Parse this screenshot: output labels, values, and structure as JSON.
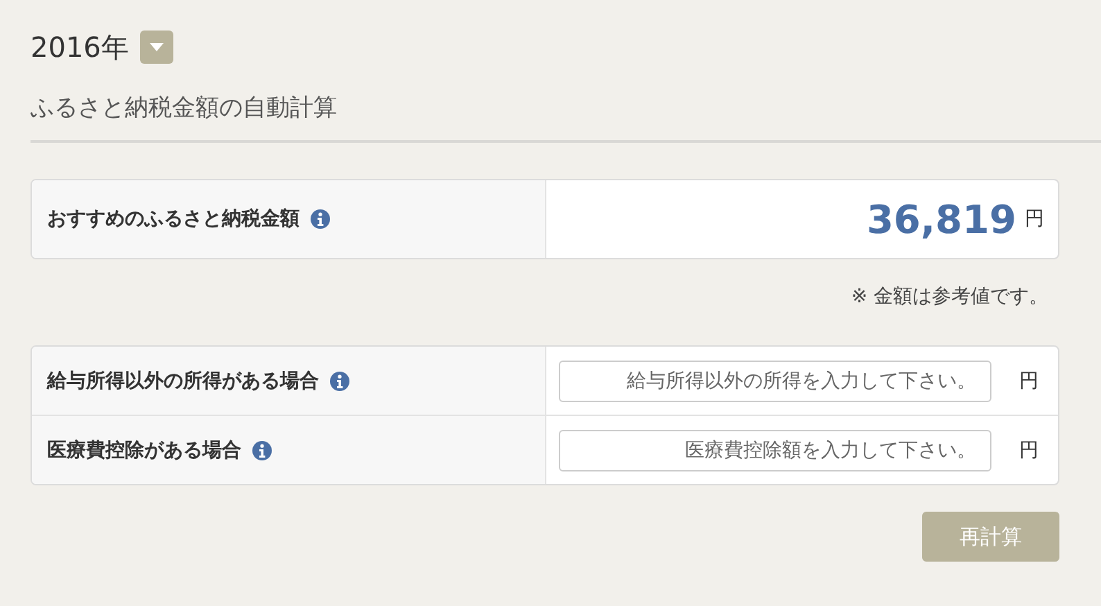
{
  "year": {
    "label": "2016年"
  },
  "subtitle": "ふるさと納税金額の自動計算",
  "recommended": {
    "label": "おすすめのふるさと納税金額",
    "amount": "36,819",
    "unit": "円"
  },
  "note": "※ 金額は参考値です。",
  "inputs": [
    {
      "label": "給与所得以外の所得がある場合",
      "placeholder": "給与所得以外の所得を入力して下さい。",
      "unit": "円"
    },
    {
      "label": "医療費控除がある場合",
      "placeholder": "医療費控除額を入力して下さい。",
      "unit": "円"
    }
  ],
  "button": "再計算"
}
